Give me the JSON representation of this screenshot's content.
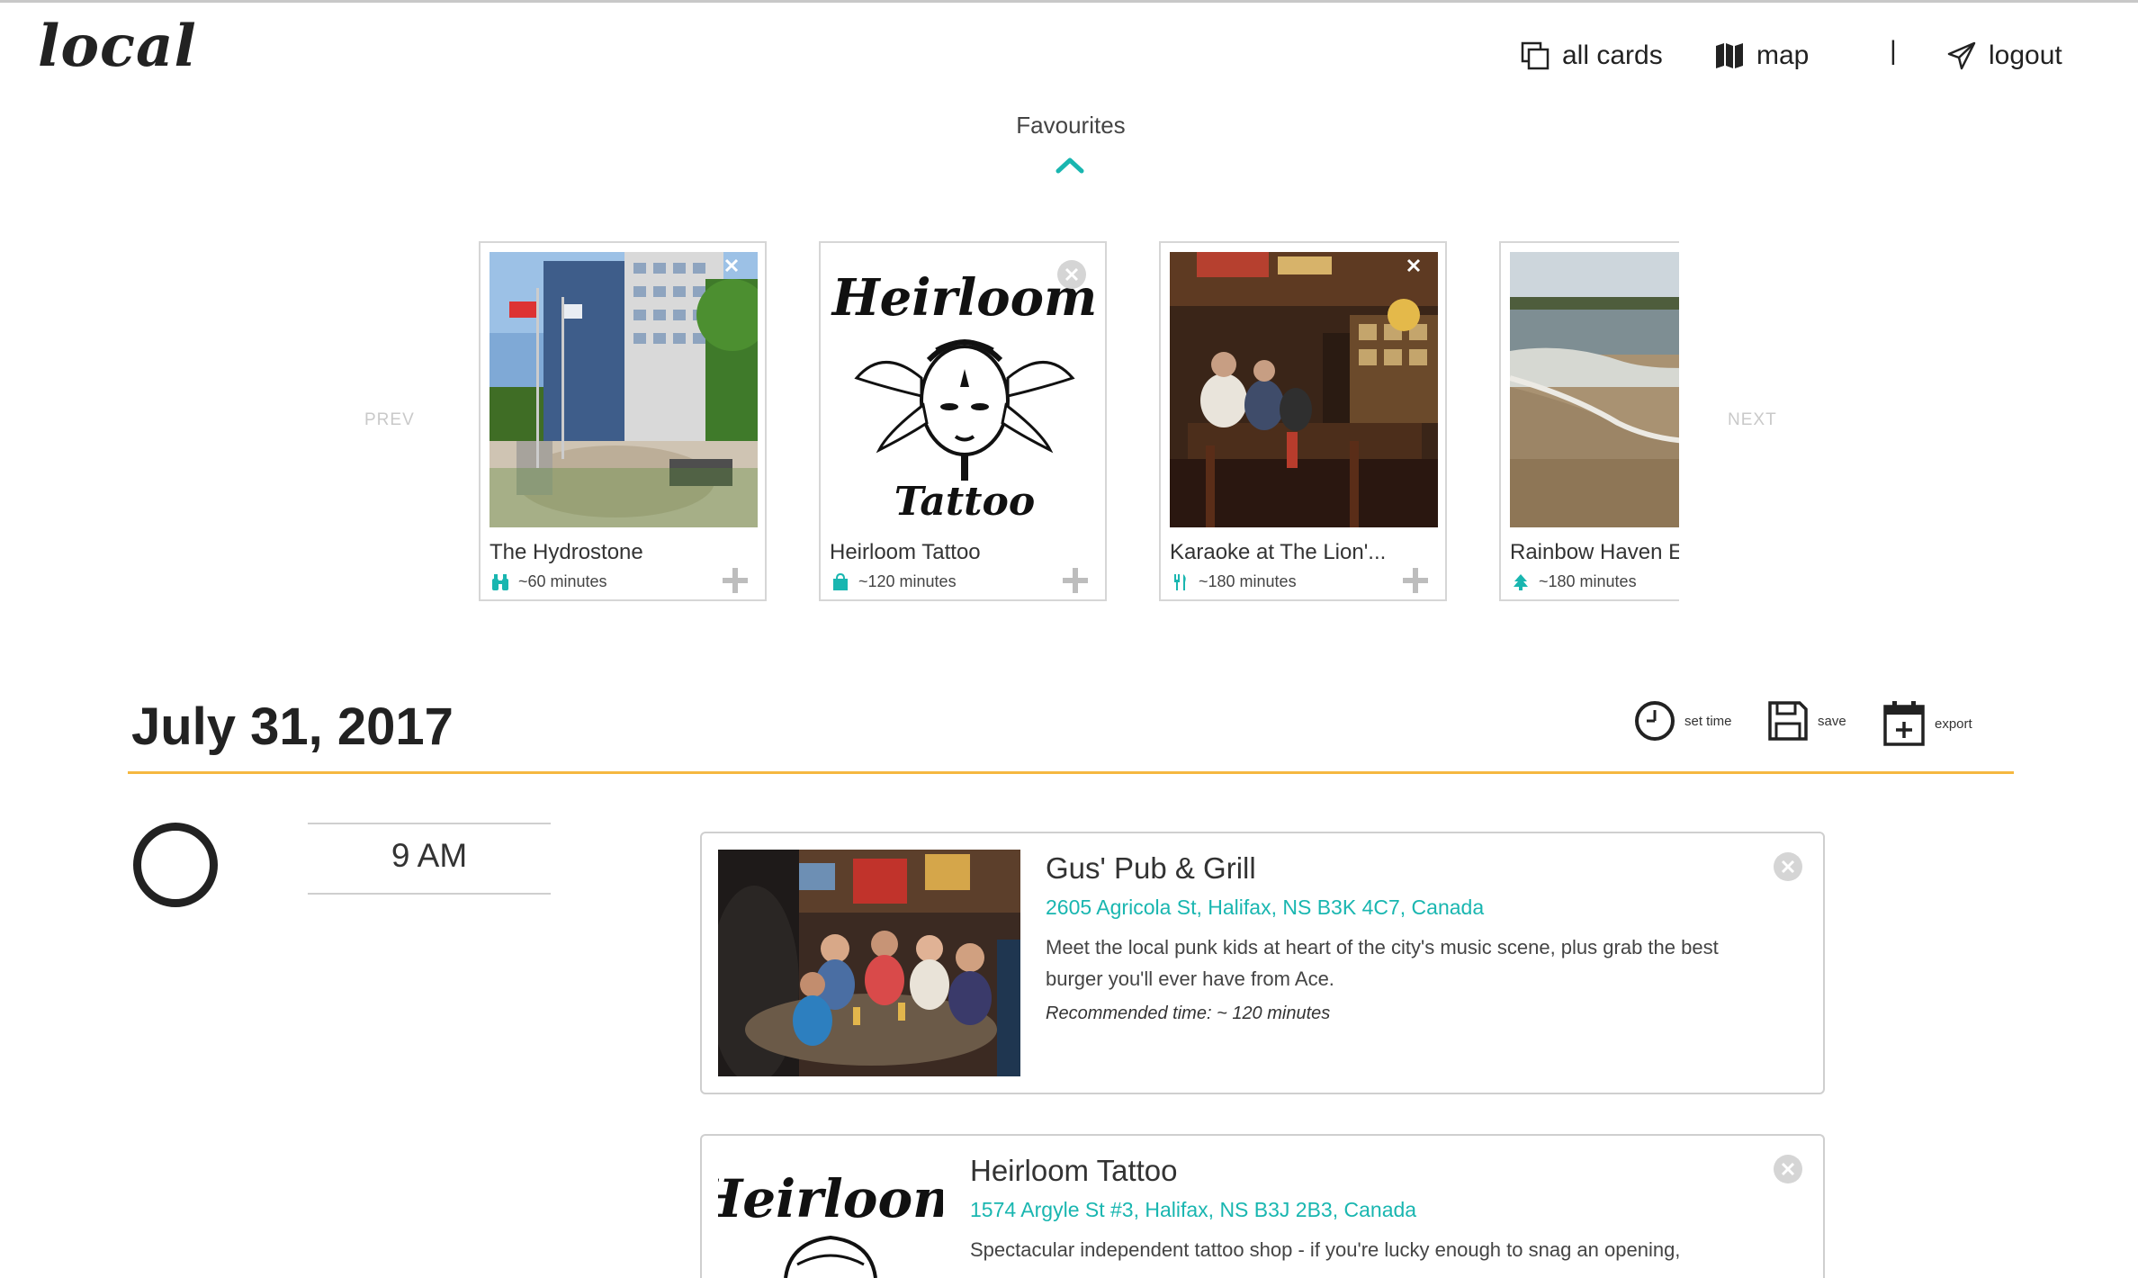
{
  "app": {
    "logo": "local"
  },
  "nav": {
    "all_cards": "all cards",
    "map": "map",
    "separator": "|",
    "logout": "logout"
  },
  "favourites": {
    "title": "Favourites",
    "prev": "PREV",
    "next": "NEXT",
    "cards": [
      {
        "name": "The Hydrostone",
        "duration": "~60 minutes",
        "icon": "binoculars-icon"
      },
      {
        "name": "Heirloom Tattoo",
        "duration": "~120 minutes",
        "icon": "shopping-bag-icon",
        "logo_top": "Heirloom",
        "logo_bottom": "Tattoo"
      },
      {
        "name": "Karaoke at The Lion'...",
        "duration": "~180 minutes",
        "icon": "utensils-icon"
      },
      {
        "name": "Rainbow Haven E",
        "duration": "~180 minutes",
        "icon": "tree-icon"
      }
    ]
  },
  "itinerary": {
    "date": "July 31, 2017",
    "tools": {
      "set_time": "set time",
      "save": "save",
      "export": "export"
    },
    "slots": [
      {
        "time": "9 AM"
      }
    ],
    "items": [
      {
        "title": "Gus' Pub & Grill",
        "address": "2605 Agricola St, Halifax, NS B3K 4C7, Canada",
        "description": "Meet the local punk kids at heart of the city's music scene, plus grab the best burger you'll ever have from Ace.",
        "recommended": "Recommended time: ~ 120 minutes"
      },
      {
        "title": "Heirloom Tattoo",
        "address": "1574 Argyle St #3, Halifax, NS B3J 2B3, Canada",
        "description": "Spectacular independent tattoo shop - if you're lucky enough to snag an opening,",
        "logo_text": "Heirloom"
      }
    ]
  },
  "colors": {
    "accent": "#19b6b0",
    "date_rule": "#f5b840"
  }
}
